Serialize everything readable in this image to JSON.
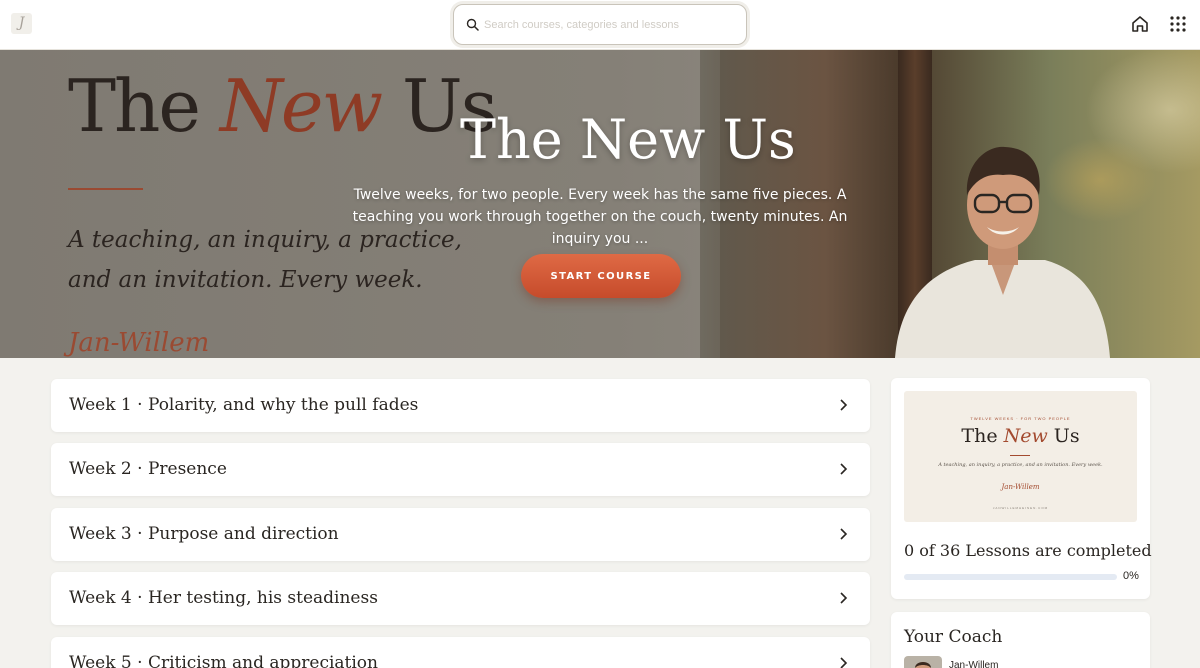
{
  "topbar": {
    "logo_glyph": "J",
    "search_placeholder": "Search courses, categories and lessons"
  },
  "hero": {
    "cover_title_main": "The ",
    "cover_title_accent": "New",
    "cover_title_end": " Us",
    "cover_tagline": "A teaching, an inquiry, a practice, and an invitation. Every week.",
    "cover_signature": "Jan-Willem",
    "title": "The New Us",
    "description": "Twelve weeks, for two people. Every week has the same five pieces. A teaching you work through together on the couch, twenty minutes. An inquiry you ...",
    "start_button": "START COURSE"
  },
  "weeks": [
    {
      "label": "Week 1 · Polarity, and why the pull fades"
    },
    {
      "label": "Week 2 · Presence"
    },
    {
      "label": "Week 3 · Purpose and direction"
    },
    {
      "label": "Week 4 · Her testing, his steadiness"
    },
    {
      "label": "Week 5 · Criticism and appreciation"
    }
  ],
  "course_card": {
    "thumb_kicker": "TWELVE WEEKS · FOR TWO PEOPLE",
    "thumb_title_main": "The ",
    "thumb_title_accent": "New",
    "thumb_title_end": " Us",
    "thumb_tagline": "A teaching, an inquiry, a practice, and an invitation. Every week.",
    "thumb_signature": "Jan-Willem",
    "thumb_url": "JANWILLEMHEINEN.COM",
    "progress_text": "0 of 36 Lessons are completed",
    "progress_value": 0,
    "progress_label": "0%"
  },
  "coach": {
    "heading": "Your Coach",
    "name": "Jan-Willem"
  },
  "colors": {
    "accent": "#c64b2b",
    "background": "#f3f2ee"
  },
  "icons": {
    "search": "search-icon",
    "home": "home-icon",
    "apps": "apps-grid-icon",
    "chevron": "chevron-right-icon"
  }
}
